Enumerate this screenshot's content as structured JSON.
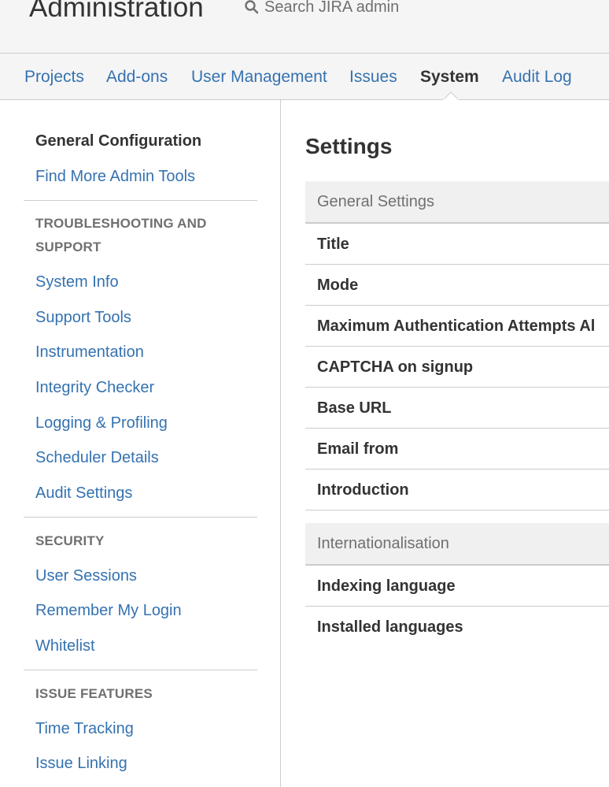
{
  "header": {
    "title": "Administration",
    "search_placeholder": "Search JIRA admin"
  },
  "tabs": [
    {
      "label": "Projects",
      "active": false
    },
    {
      "label": "Add-ons",
      "active": false
    },
    {
      "label": "User Management",
      "active": false
    },
    {
      "label": "Issues",
      "active": false
    },
    {
      "label": "System",
      "active": true
    },
    {
      "label": "Audit Log",
      "active": false
    }
  ],
  "sidebar": {
    "top_items": [
      {
        "label": "General Configuration",
        "current": true
      },
      {
        "label": "Find More Admin Tools",
        "current": false
      }
    ],
    "sections": [
      {
        "heading": "TROUBLESHOOTING AND SUPPORT",
        "items": [
          "System Info",
          "Support Tools",
          "Instrumentation",
          "Integrity Checker",
          "Logging & Profiling",
          "Scheduler Details",
          "Audit Settings"
        ]
      },
      {
        "heading": "SECURITY",
        "items": [
          "User Sessions",
          "Remember My Login",
          "Whitelist"
        ]
      },
      {
        "heading": "ISSUE FEATURES",
        "items": [
          "Time Tracking",
          "Issue Linking"
        ]
      }
    ]
  },
  "main": {
    "title": "Settings",
    "groups": [
      {
        "heading": "General Settings",
        "rows": [
          "Title",
          "Mode",
          "Maximum Authentication Attempts Al",
          "CAPTCHA on signup",
          "Base URL",
          "Email from",
          "Introduction"
        ]
      },
      {
        "heading": "Internationalisation",
        "rows": [
          "Indexing language",
          "Installed languages"
        ]
      }
    ]
  },
  "colors": {
    "link": "#3572b0",
    "text": "#333333",
    "muted": "#707070",
    "border": "#cccccc",
    "header_bg": "#f5f5f5"
  }
}
